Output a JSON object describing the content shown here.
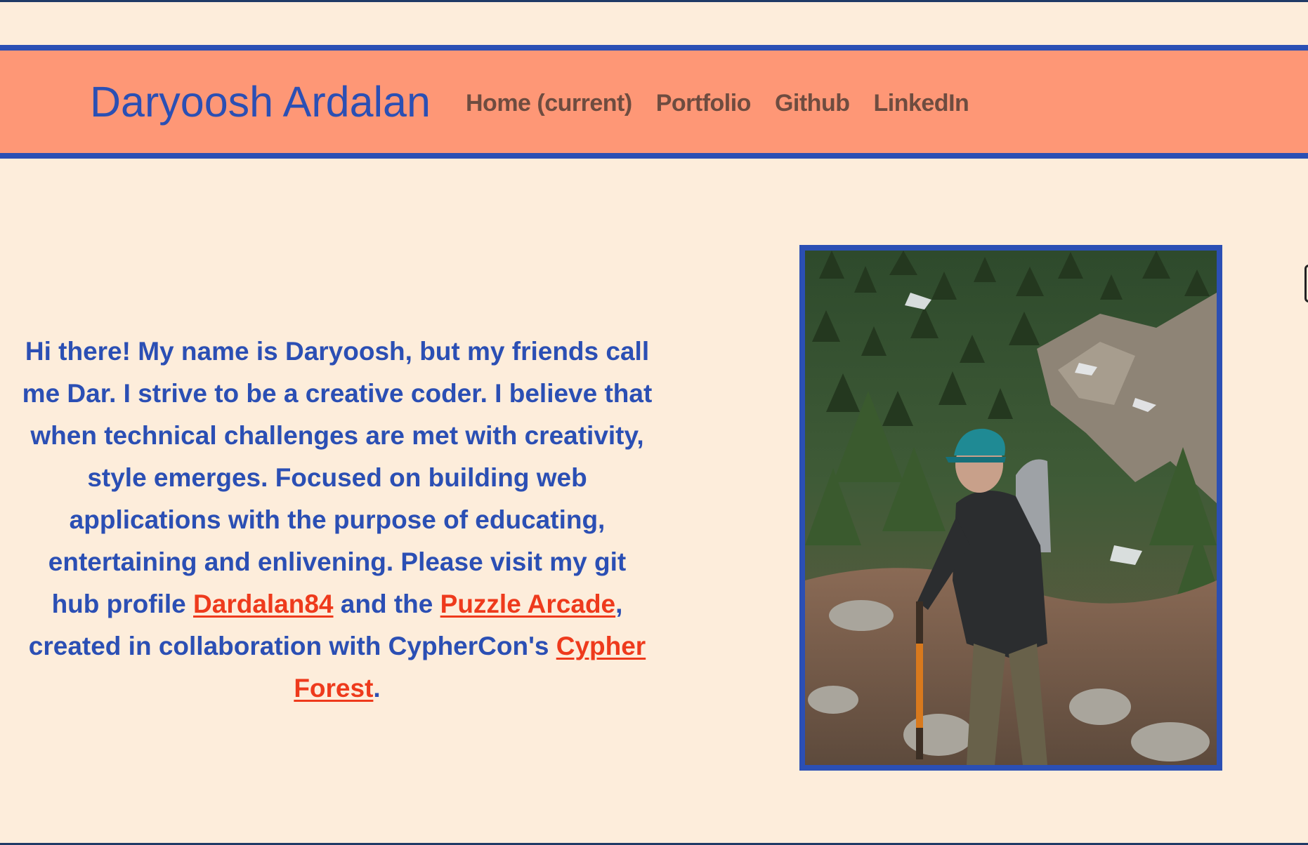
{
  "header": {
    "brand": "Daryoosh Ardalan",
    "nav": [
      {
        "label": "Home (current)"
      },
      {
        "label": "Portfolio"
      },
      {
        "label": "Github"
      },
      {
        "label": "LinkedIn"
      }
    ]
  },
  "intro": {
    "text_1": "Hi there! My name is Daryoosh, but my friends call me Dar. I strive to be a creative coder. I believe that when technical challenges are met with creativity, style emerges. Focused on building web applications with the purpose of educating, entertaining and enlivening. Please visit my git hub profile ",
    "link_github": "Dardalan84",
    "text_2": " and the ",
    "link_puzzle": "Puzzle Arcade",
    "text_3": ", created in collaboration with CypherCon's ",
    "link_cypher": "Cypher Forest",
    "text_4": "."
  },
  "profile_photo": {
    "icon": "profile-photo-hiker"
  },
  "colors": {
    "background": "#fdeddb",
    "navbar": "#fe9776",
    "accent_blue": "#2b4fb4",
    "nav_text": "#6e4c40",
    "link_red": "#ee3a1c"
  }
}
